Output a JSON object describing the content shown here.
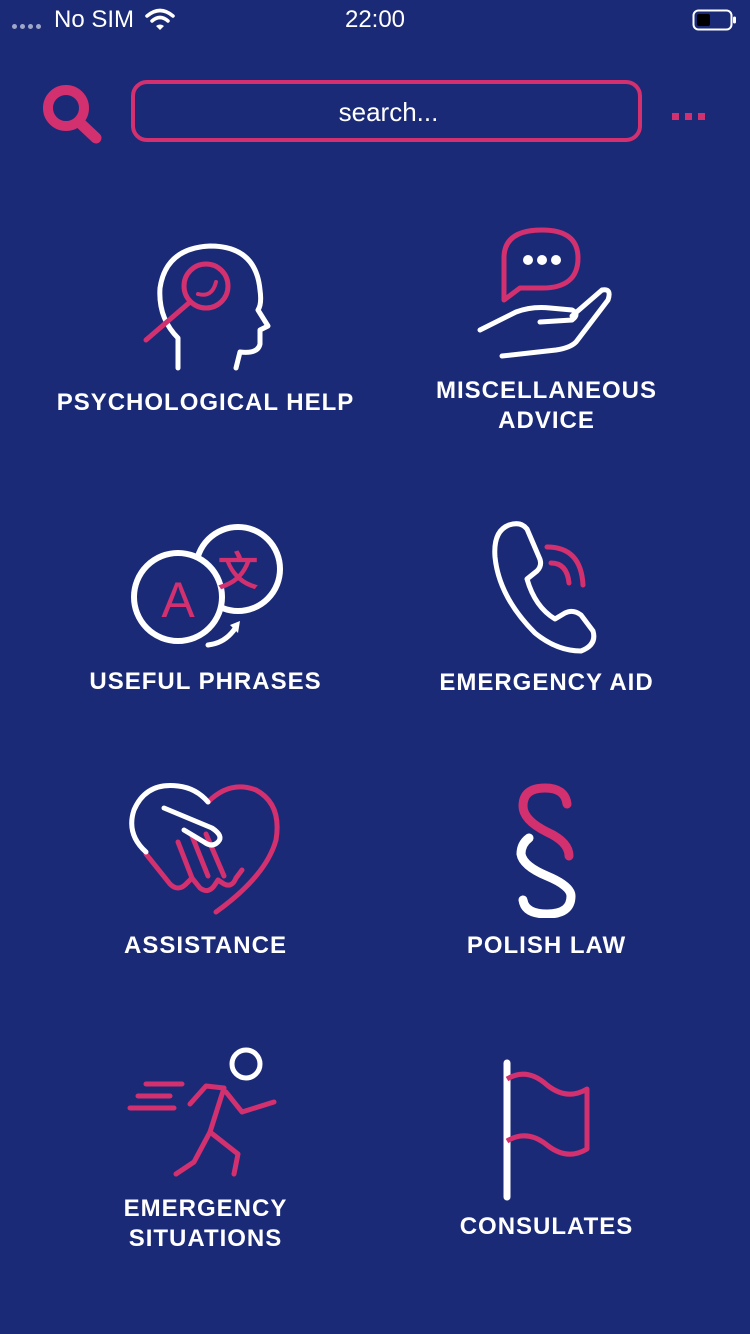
{
  "status_bar": {
    "carrier": "No SIM",
    "time": "22:00"
  },
  "header": {
    "search_placeholder": "search...",
    "search_icon": "search-icon",
    "more_icon": "more-icon"
  },
  "colors": {
    "background": "#1b2a77",
    "accent": "#d3306f",
    "text": "#ffffff"
  },
  "categories": [
    {
      "label": "PSYCHOLOGICAL HELP",
      "icon": "head-magnifier-icon"
    },
    {
      "label": "MISCELLANEOUS\nADVICE",
      "icon": "hand-speech-bubble-icon"
    },
    {
      "label": "USEFUL PHRASES",
      "icon": "translate-icon"
    },
    {
      "label": "EMERGENCY AID",
      "icon": "phone-icon"
    },
    {
      "label": "ASSISTANCE",
      "icon": "handshake-heart-icon"
    },
    {
      "label": "POLISH LAW",
      "icon": "section-sign-icon"
    },
    {
      "label": "EMERGENCY\nSITUATIONS",
      "icon": "running-person-icon"
    },
    {
      "label": "CONSULATES",
      "icon": "flag-icon"
    }
  ]
}
